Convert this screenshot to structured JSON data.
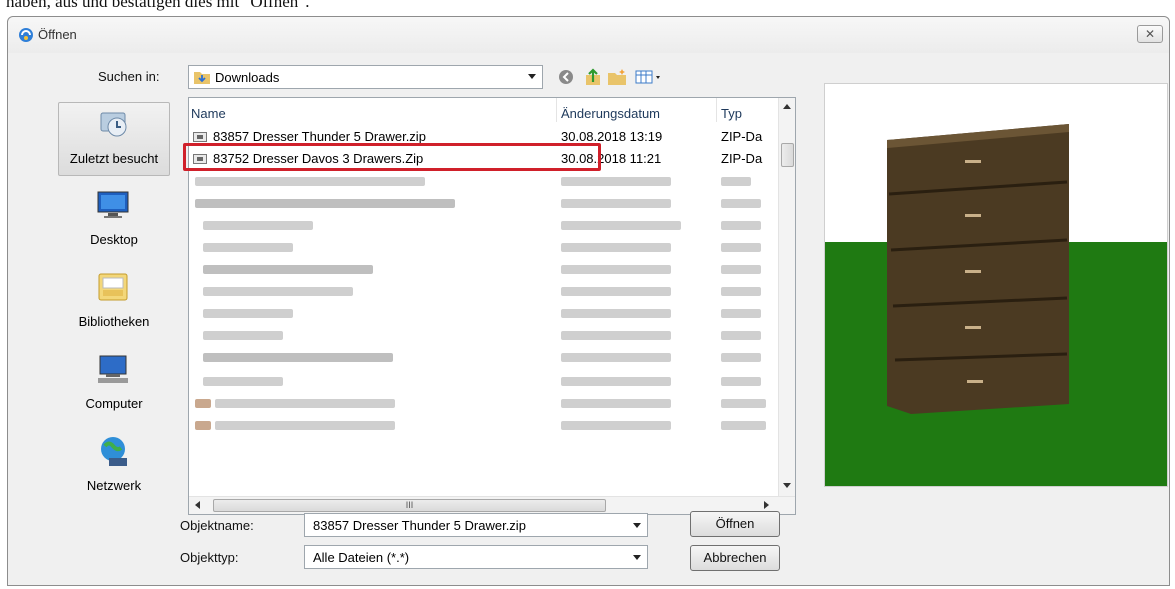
{
  "caption": "haben, aus und bestätigen dies mit \"Öffnen\".",
  "dialog": {
    "title": "Öffnen",
    "close_glyph": "✕"
  },
  "lookin": {
    "label": "Suchen in:",
    "value": "Downloads"
  },
  "toolbar": {
    "icons": [
      "back-icon",
      "up-folder-icon",
      "new-folder-icon",
      "view-menu-icon"
    ]
  },
  "places": [
    {
      "label": "Zuletzt besucht",
      "icon": "recent-places-icon"
    },
    {
      "label": "Desktop",
      "icon": "desktop-icon"
    },
    {
      "label": "Bibliotheken",
      "icon": "libraries-icon"
    },
    {
      "label": "Computer",
      "icon": "computer-icon"
    },
    {
      "label": "Netzwerk",
      "icon": "network-icon"
    }
  ],
  "filelist": {
    "columns": [
      "Name",
      "Änderungsdatum",
      "Typ"
    ],
    "rows": [
      {
        "name": "83857 Dresser Thunder 5 Drawer.zip",
        "date": "30.08.2018 13:19",
        "type": "ZIP-Da"
      },
      {
        "name": "83752 Dresser Davos 3 Drawers.Zip",
        "date": "30.08.2018 11:21",
        "type": "ZIP-Da"
      }
    ],
    "hscroll_glyph": "III"
  },
  "filename": {
    "label": "Objektname:",
    "value": "83857 Dresser Thunder 5 Drawer.zip"
  },
  "filetype": {
    "label": "Objekttyp:",
    "value": "Alle Dateien (*.*)"
  },
  "buttons": {
    "open": "Öffnen",
    "cancel": "Abbrechen"
  },
  "colors": {
    "highlight": "#d0202a",
    "preview_sky": "#ffffff",
    "preview_ground": "#1f7a12",
    "dresser_wood": "#4b3a22"
  }
}
